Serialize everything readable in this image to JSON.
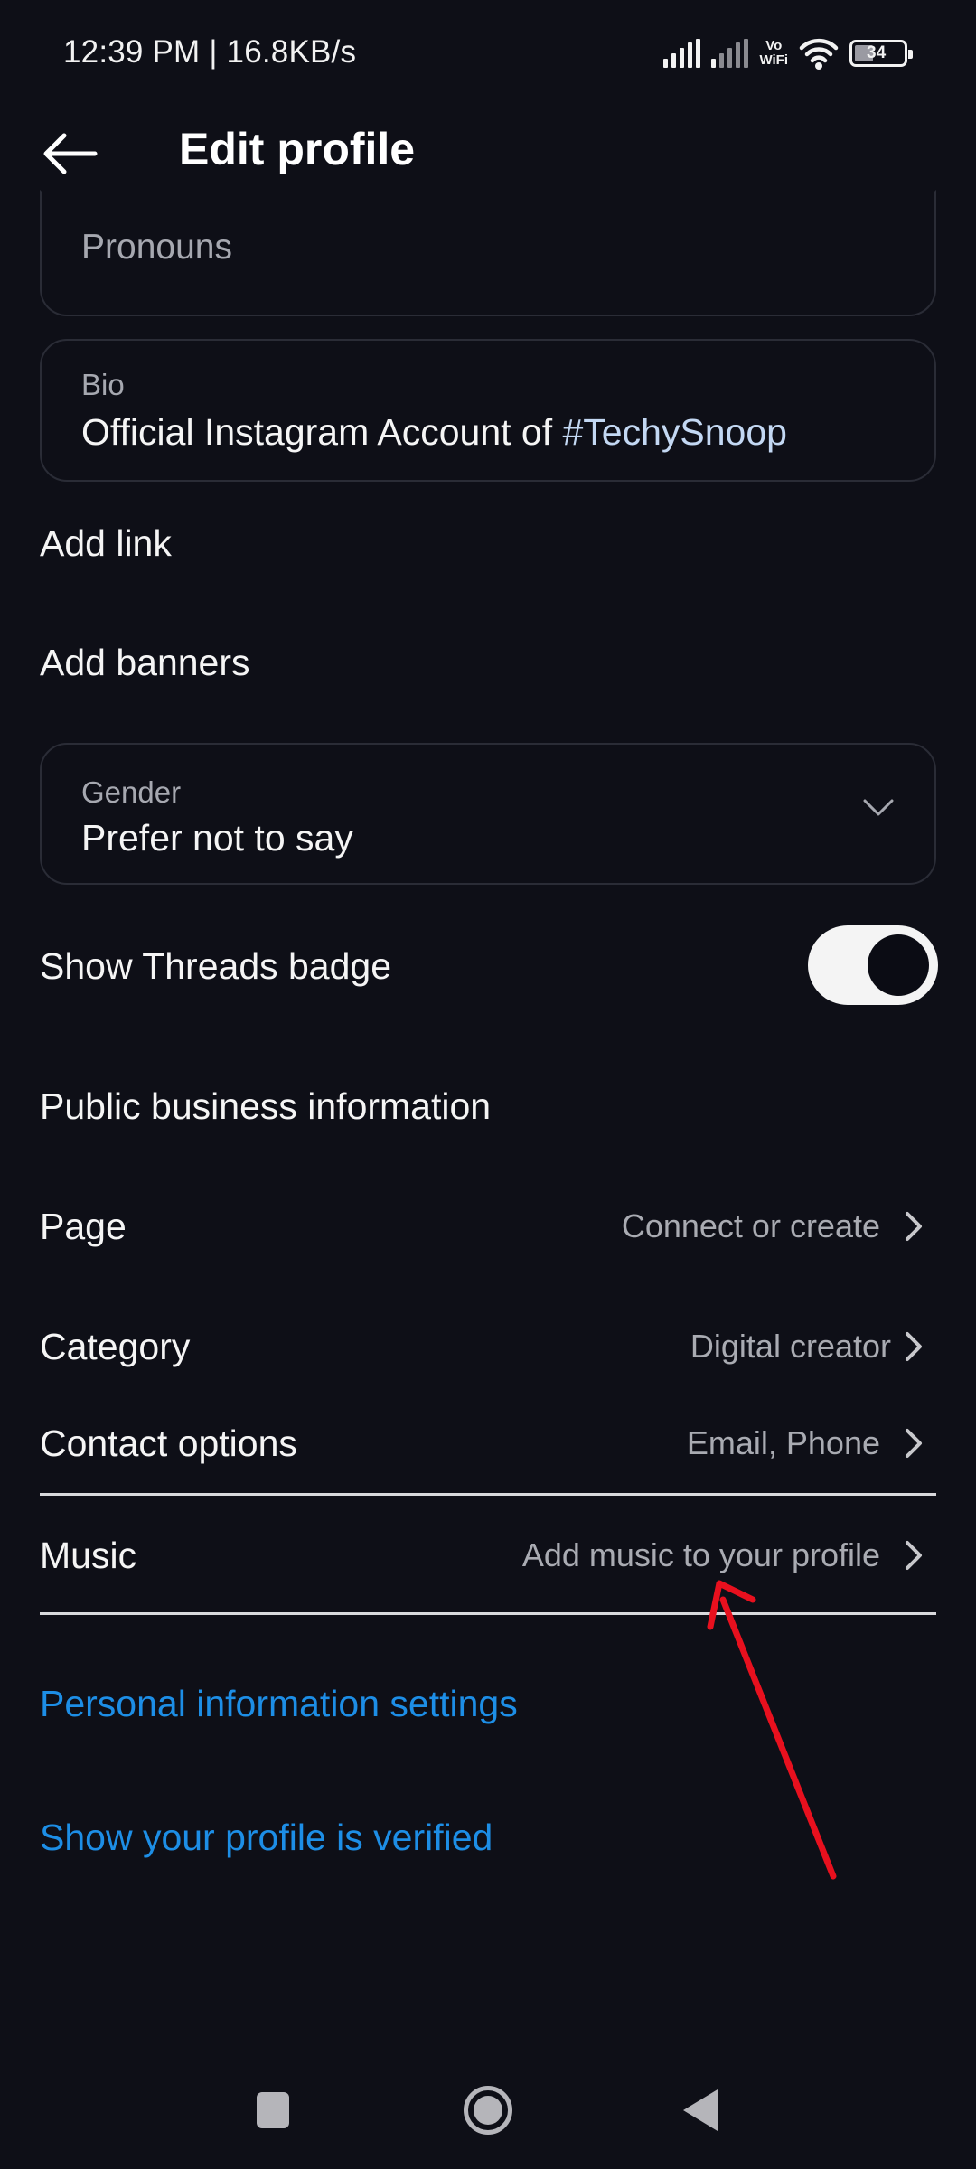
{
  "status_bar": {
    "time_speed": "12:39 PM | 16.8KB/s",
    "vowifi_top": "Vo",
    "vowifi_bottom": "WiFi",
    "battery_level": "34",
    "battery_fraction": 0.34
  },
  "header": {
    "title": "Edit profile",
    "back_icon": "arrow-left-icon"
  },
  "form": {
    "pronouns": {
      "placeholder": "Pronouns"
    },
    "bio": {
      "label": "Bio",
      "value_prefix": "Official Instagram Account of ",
      "value_hashtag": "#TechySnoop"
    },
    "add_link": "Add link",
    "add_banners": "Add banners",
    "gender": {
      "label": "Gender",
      "value": "Prefer not to say"
    },
    "threads_badge": {
      "label": "Show Threads badge",
      "enabled": true
    }
  },
  "business": {
    "section_title": "Public business information",
    "rows": [
      {
        "label": "Page",
        "value": "Connect or create"
      },
      {
        "label": "Category",
        "value": "Digital creator"
      },
      {
        "label": "Contact options",
        "value": "Email, Phone"
      },
      {
        "label": "Music",
        "value": "Add music to your profile"
      }
    ]
  },
  "links": {
    "personal_info": "Personal information settings",
    "verified": "Show your profile is verified"
  },
  "colors": {
    "background": "#0e0f17",
    "link_blue": "#1d8ee6",
    "hashtag": "#c3d8f3",
    "annotation_red": "#e8101e"
  },
  "nav_bar": {
    "recent_icon": "square-icon",
    "home_icon": "circle-icon",
    "back_icon": "triangle-back-icon"
  }
}
